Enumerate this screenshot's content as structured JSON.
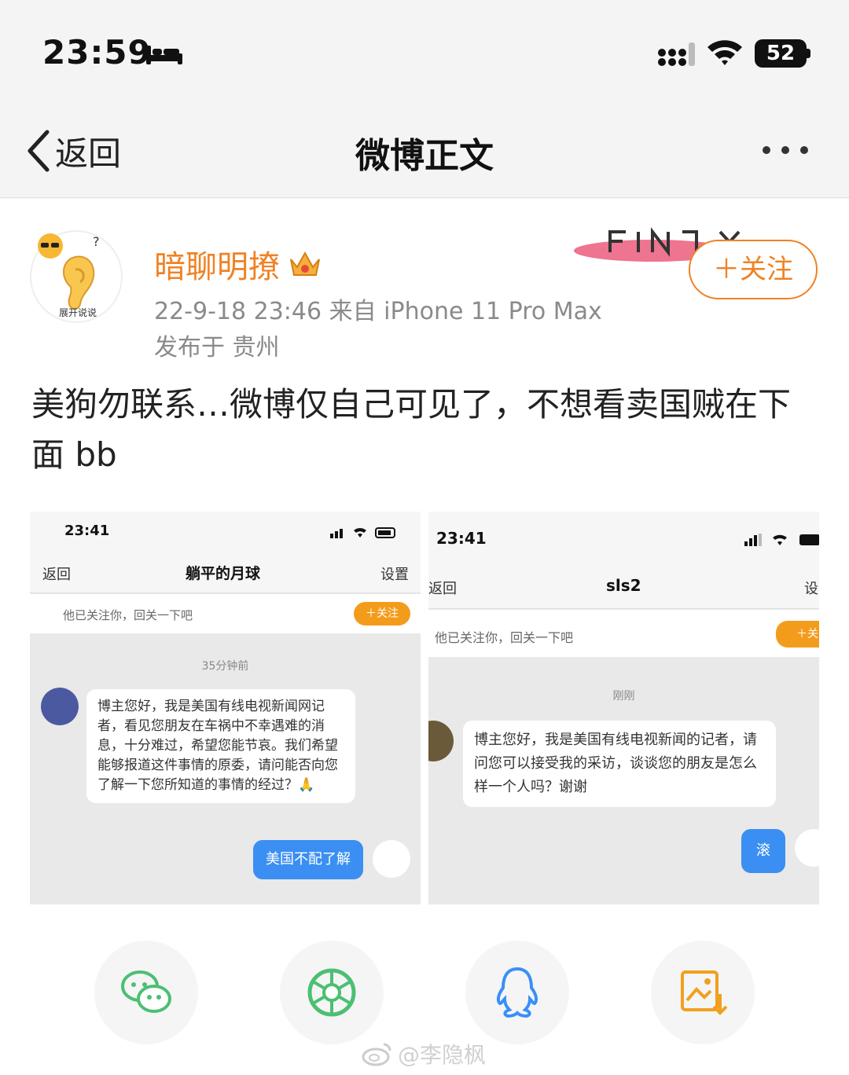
{
  "status_bar": {
    "time": "23:59",
    "battery": "52"
  },
  "nav": {
    "back_label": "返回",
    "title": "微博正文"
  },
  "post": {
    "avatar_caption": "展开说说",
    "username": "暗聊明撩",
    "meta": "22-9-18 23:46  来自 iPhone 11 Pro Max",
    "location": "发布于 贵州",
    "follow_label": "＋关注",
    "text": "美狗勿联系…微博仅自己可见了，不想看卖国贼在下面 bb"
  },
  "screenshots": [
    {
      "time": "23:41",
      "back": "返回",
      "title": "躺平的月球",
      "right": "设置",
      "follow_hint": "他已关注你，回关一下吧",
      "follow_btn": "＋关注",
      "stamp": "35分钟前",
      "message": "博主您好，我是美国有线电视新闻网记者，看见您朋友在车祸中不幸遇难的消息，十分难过，希望您能节哀。我们希望能够报道这件事情的原委，请问能否向您了解一下您所知道的事情的经过？🙏",
      "reply": "美国不配了解"
    },
    {
      "time": "23:41",
      "back": "返回",
      "title": "sls2",
      "right": "设",
      "follow_hint": "他已关注你，回关一下吧",
      "follow_btn": "＋关",
      "stamp": "刚刚",
      "message": "博主您好，我是美国有线电视新闻的记者，请问您可以接受我的采访，谈谈您的朋友是怎么样一个人吗？谢谢",
      "reply": "滚"
    }
  ],
  "share": {
    "icons": [
      "wechat-icon",
      "moments-icon",
      "qq-icon",
      "save-image-icon"
    ],
    "colors": {
      "wechat": "#4cbf73",
      "moments": "#4cbf73",
      "qq": "#3a8ff7",
      "save": "#f0a020"
    }
  },
  "watermark": "@李隐枫",
  "accent_color": "#f08224"
}
